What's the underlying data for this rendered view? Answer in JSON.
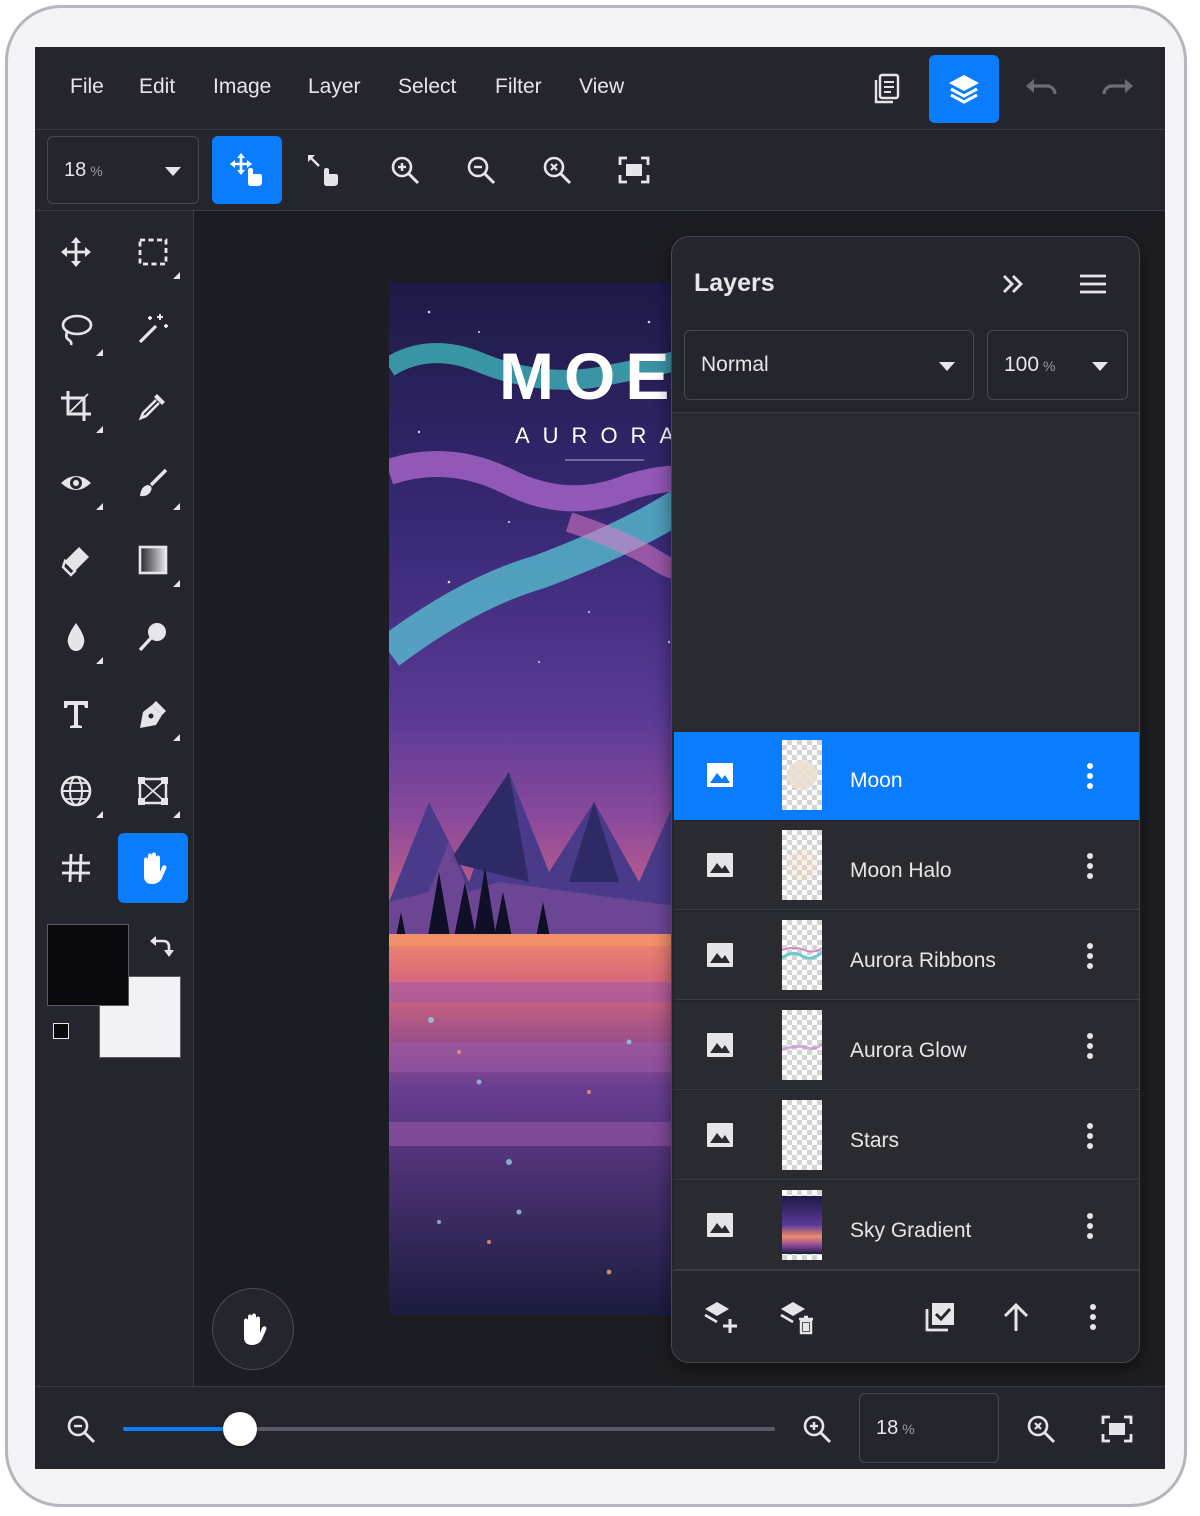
{
  "menubar": {
    "items": [
      "File",
      "Edit",
      "Image",
      "Layer",
      "Select",
      "Filter",
      "View"
    ]
  },
  "toolbar": {
    "zoom_value": "18",
    "zoom_unit": "%"
  },
  "canvas": {
    "title_text": "MOE",
    "subtitle_text": "AURORA"
  },
  "layers_panel": {
    "title": "Layers",
    "blend_mode": "Normal",
    "opacity_value": "100",
    "opacity_unit": "%",
    "layers": [
      {
        "name": "Moon",
        "selected": true
      },
      {
        "name": "Moon Halo",
        "selected": false
      },
      {
        "name": "Aurora Ribbons",
        "selected": false
      },
      {
        "name": "Aurora Glow",
        "selected": false
      },
      {
        "name": "Stars",
        "selected": false
      },
      {
        "name": "Sky Gradient",
        "selected": false
      }
    ]
  },
  "bottombar": {
    "zoom_value": "18",
    "zoom_unit": "%",
    "slider_value": 0.18
  },
  "colors": {
    "accent": "#0a7cff",
    "foreground_color": "#0a0a0c",
    "background_color": "#f2f2f4"
  }
}
